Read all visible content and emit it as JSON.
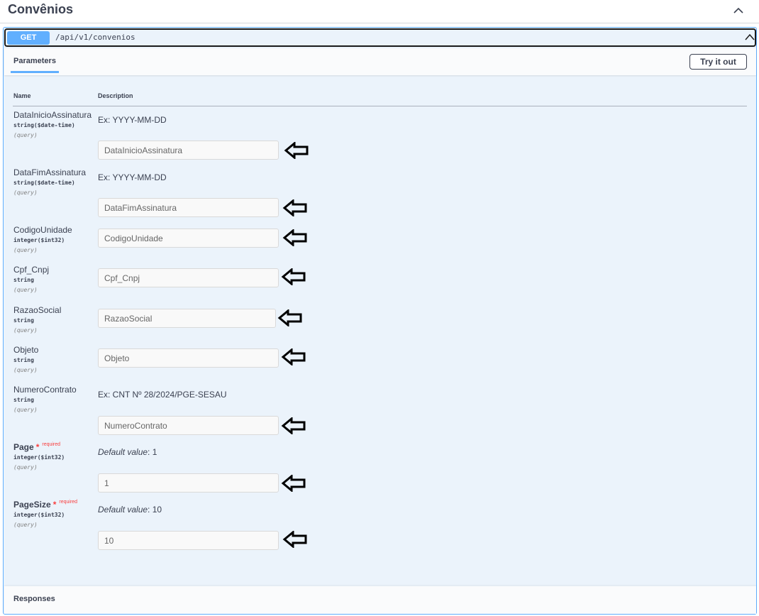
{
  "tag": {
    "title": "Convênios"
  },
  "operation": {
    "method": "GET",
    "path": "/api/v1/convenios"
  },
  "section": {
    "tab_label": "Parameters",
    "try_button": "Try it out"
  },
  "columns": {
    "name": "Name",
    "description": "Description"
  },
  "params": [
    {
      "name": "DataInicioAssinatura",
      "type": "string($date-time)",
      "in": "(query)",
      "description": "Ex: YYYY-MM-DD",
      "placeholder": "DataInicioAssinatura"
    },
    {
      "name": "DataFimAssinatura",
      "type": "string($date-time)",
      "in": "(query)",
      "description": "Ex: YYYY-MM-DD",
      "placeholder": "DataFimAssinatura"
    },
    {
      "name": "CodigoUnidade",
      "type": "integer($int32)",
      "in": "(query)",
      "placeholder": "CodigoUnidade"
    },
    {
      "name": "Cpf_Cnpj",
      "type": "string",
      "in": "(query)",
      "placeholder": "Cpf_Cnpj"
    },
    {
      "name": "RazaoSocial",
      "type": "string",
      "in": "(query)",
      "placeholder": "RazaoSocial"
    },
    {
      "name": "Objeto",
      "type": "string",
      "in": "(query)",
      "placeholder": "Objeto"
    },
    {
      "name": "NumeroContrato",
      "type": "string",
      "in": "(query)",
      "description": "Ex: CNT Nº 28/2024/PGE-SESAU",
      "placeholder": "NumeroContrato"
    },
    {
      "name": "Page",
      "required_mark": "*",
      "required_label": "required",
      "type": "integer($int32)",
      "in": "(query)",
      "default_label": "Default value",
      "default_sep": ": ",
      "default_value": "1",
      "placeholder": "1"
    },
    {
      "name": "PageSize",
      "required_mark": "*",
      "required_label": "required",
      "type": "integer($int32)",
      "in": "(query)",
      "default_label": "Default value",
      "default_sep": ": ",
      "default_value": "10",
      "placeholder": "10"
    }
  ],
  "responses": {
    "label": "Responses"
  },
  "icons": {
    "collapse": "chevron-up-icon",
    "annotation": "left-arrow-icon"
  },
  "colors": {
    "method_get": "#61affe",
    "block_bg": "#ebf3fb",
    "required": "#f93e3e"
  }
}
